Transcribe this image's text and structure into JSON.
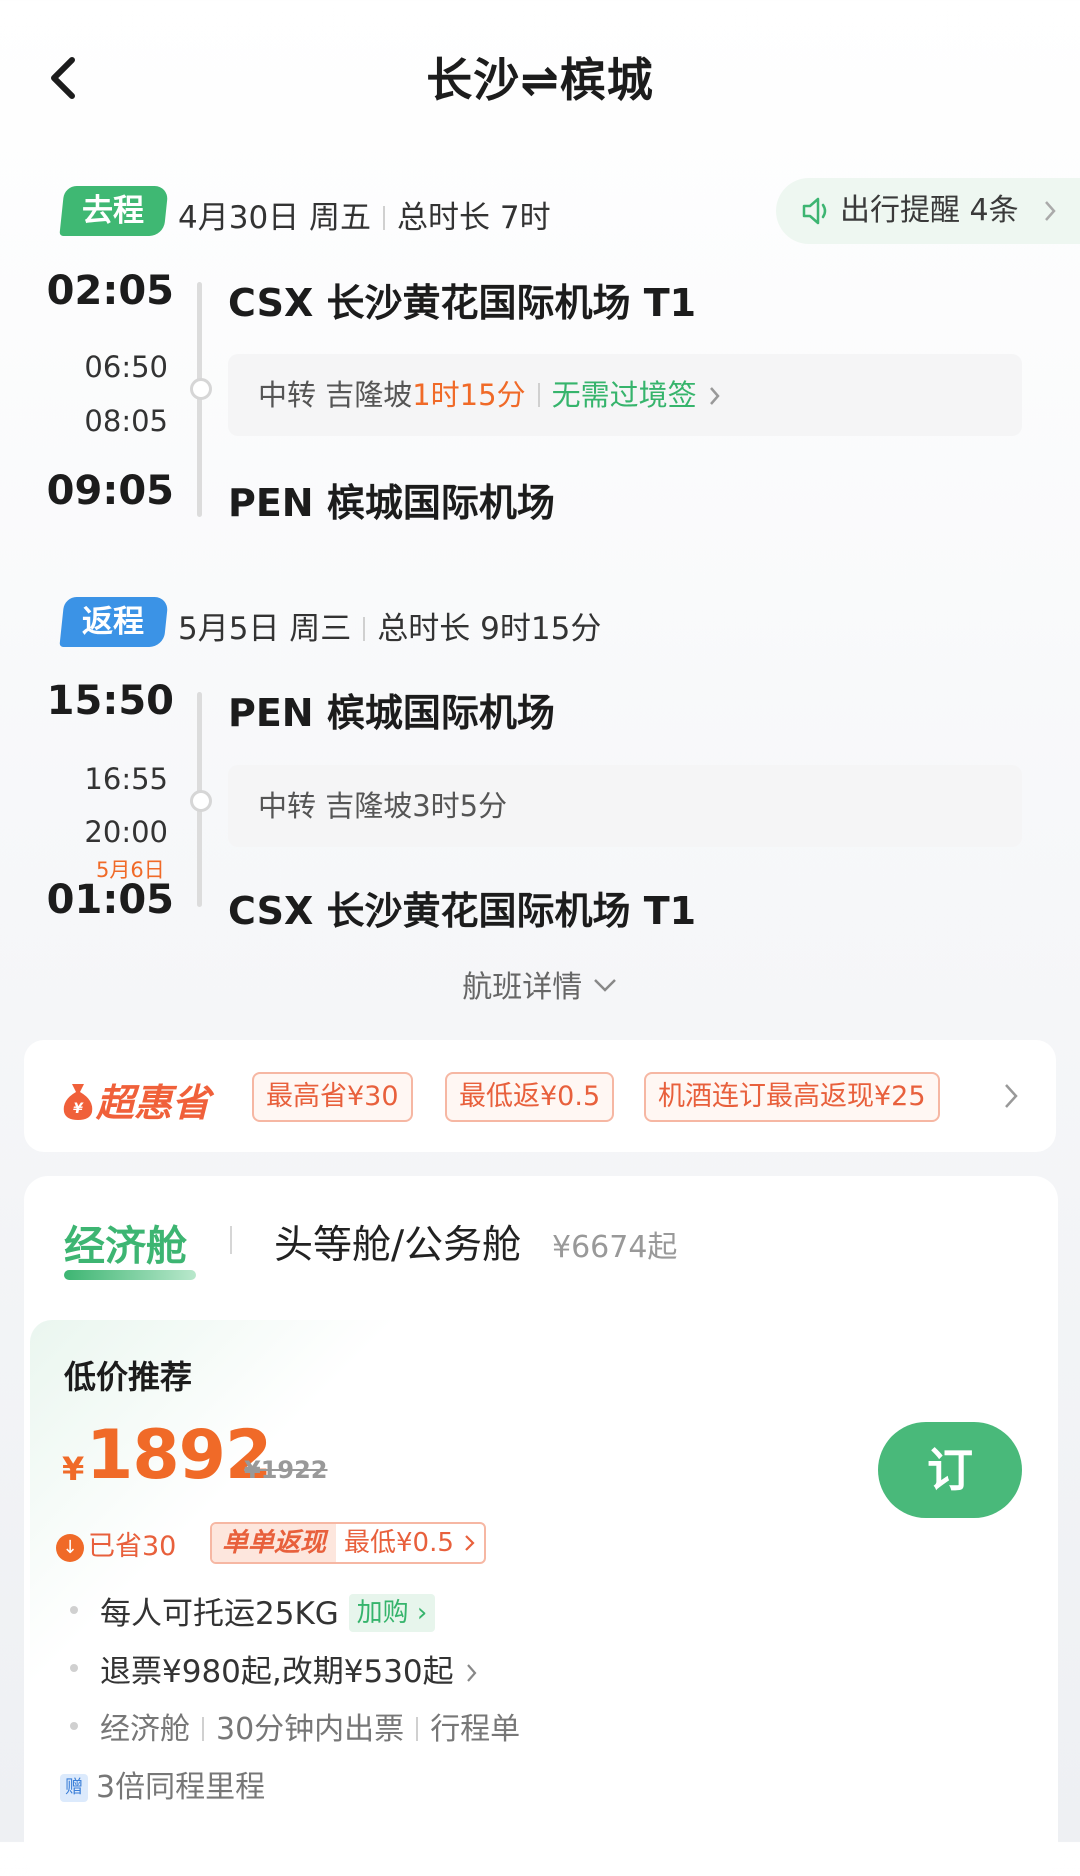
{
  "header": {
    "title": "长沙⇌槟城"
  },
  "outbound": {
    "tag": "去程",
    "date": "4月30日 周五",
    "duration": "总时长 7时",
    "reminder": "出行提醒 4条",
    "dep_time": "02:05",
    "dep_airport": "CSX 长沙黄花国际机场 T1",
    "transfer_arr": "06:50",
    "transfer_dep": "08:05",
    "transfer_label": "中转 吉隆坡",
    "transfer_duration": "1时15分",
    "visa": "无需过境签",
    "arr_time": "09:05",
    "arr_airport": "PEN 槟城国际机场"
  },
  "return": {
    "tag": "返程",
    "date": "5月5日 周三",
    "duration": "总时长 9时15分",
    "dep_time": "15:50",
    "dep_airport": "PEN 槟城国际机场",
    "transfer_arr": "16:55",
    "transfer_dep": "20:00",
    "transfer_text": "中转 吉隆坡3时5分",
    "next_day": "5月6日",
    "arr_time": "01:05",
    "arr_airport": "CSX 长沙黄花国际机场 T1"
  },
  "flight_detail": "航班详情",
  "promo": {
    "logo": "超惠省",
    "chips": [
      "最高省¥30",
      "最低返¥0.5",
      "机酒连订最高返现¥25"
    ]
  },
  "cabins": {
    "economy": "经济舱",
    "business": "头等舱/公务舱",
    "business_price": "¥6674起"
  },
  "recommend": {
    "title": "低价推荐",
    "currency": "¥",
    "price": "1892",
    "original_price": "¥1922",
    "book": "订",
    "saved": "已省30",
    "cashback_head": "单单返现",
    "cashback_tail": "最低¥0.5",
    "baggage": "每人可托运25KG",
    "baggage_buy": "加购",
    "refund": "退票¥980起,改期¥530起",
    "tags": [
      "经济舱",
      "30分钟内出票",
      "行程单"
    ],
    "gift_badge": "赠",
    "gift": "3倍同程里程"
  },
  "colors": {
    "green": "#3db572",
    "orange": "#f06a28",
    "blue": "#3b93e6"
  },
  "icons": [
    "back-arrow-icon",
    "speaker-icon",
    "chevron-right-icon",
    "chevron-down-icon",
    "moneybag-icon"
  ]
}
